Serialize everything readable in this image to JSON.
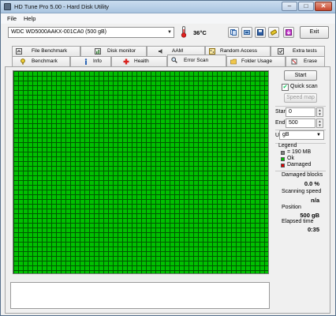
{
  "window": {
    "title": "HD Tune Pro 5.00 - Hard Disk Utility",
    "minimize": "–",
    "maximize": "□",
    "close": "✕"
  },
  "menu": {
    "file": "File",
    "help": "Help"
  },
  "toolbar": {
    "drive": "WDC WD5000AAKX-001CA0 (500 gB)",
    "temperature": "36°C",
    "exit": "Exit",
    "icons": [
      "copy-info-icon",
      "copy-screenshot-icon",
      "save-icon",
      "options-icon",
      "download-icon"
    ]
  },
  "tabs_top": [
    {
      "label": "File Benchmark",
      "icon": "file-benchmark-icon"
    },
    {
      "label": "Disk monitor",
      "icon": "disk-monitor-icon"
    },
    {
      "label": "AAM",
      "icon": "aam-icon"
    },
    {
      "label": "Random Access",
      "icon": "random-access-icon"
    },
    {
      "label": "Extra tests",
      "icon": "extra-tests-icon"
    }
  ],
  "tabs_bottom": [
    {
      "label": "Benchmark",
      "icon": "benchmark-icon"
    },
    {
      "label": "Info",
      "icon": "info-icon"
    },
    {
      "label": "Health",
      "icon": "health-icon"
    },
    {
      "label": "Error Scan",
      "icon": "error-scan-icon",
      "active": true
    },
    {
      "label": "Folder Usage",
      "icon": "folder-icon"
    },
    {
      "label": "Erase",
      "icon": "erase-icon"
    }
  ],
  "controls": {
    "start": "Start",
    "quick_scan": "Quick scan",
    "quick_scan_checked": true,
    "speed_map": "Speed map",
    "start_label": "Start",
    "start_value": "0",
    "end_label": "End",
    "end_value": "500",
    "unit_label": "Unit",
    "unit_value": "gB"
  },
  "legend": {
    "title": "Legend",
    "block": "= 190 MB",
    "ok": "Ok",
    "damaged": "Damaged",
    "colors": {
      "block": "#808080",
      "ok": "#00c000",
      "damaged": "#e00000"
    }
  },
  "stats": {
    "damaged_label": "Damaged blocks",
    "damaged_value": "0.0 %",
    "speed_label": "Scanning speed",
    "speed_value": "n/a",
    "position_label": "Position",
    "position_value": "500 gB",
    "elapsed_label": "Elapsed time",
    "elapsed_value": "0:35"
  },
  "scan": {
    "status": "complete",
    "colors": {
      "ok": "#00c000",
      "gridline": "#005800"
    }
  }
}
